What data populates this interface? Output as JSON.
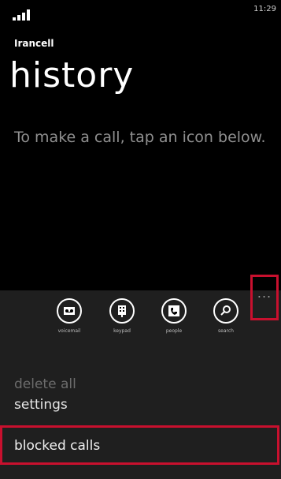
{
  "status": {
    "time": "11:29",
    "signal_icon": "signal-bars-icon"
  },
  "header": {
    "carrier": "Irancell",
    "title": "history"
  },
  "main": {
    "hint": "To make a call, tap an icon below."
  },
  "appbar": {
    "buttons": [
      {
        "label": "voicemail",
        "icon": "voicemail-icon"
      },
      {
        "label": "keypad",
        "icon": "keypad-icon"
      },
      {
        "label": "people",
        "icon": "people-icon"
      },
      {
        "label": "search",
        "icon": "search-icon"
      }
    ],
    "more": "...",
    "menu": [
      "delete all",
      "settings",
      "blocked calls"
    ]
  },
  "colors": {
    "highlight": "#c8102e",
    "appbar_bg": "#1f1f1f",
    "bg": "#000000"
  }
}
